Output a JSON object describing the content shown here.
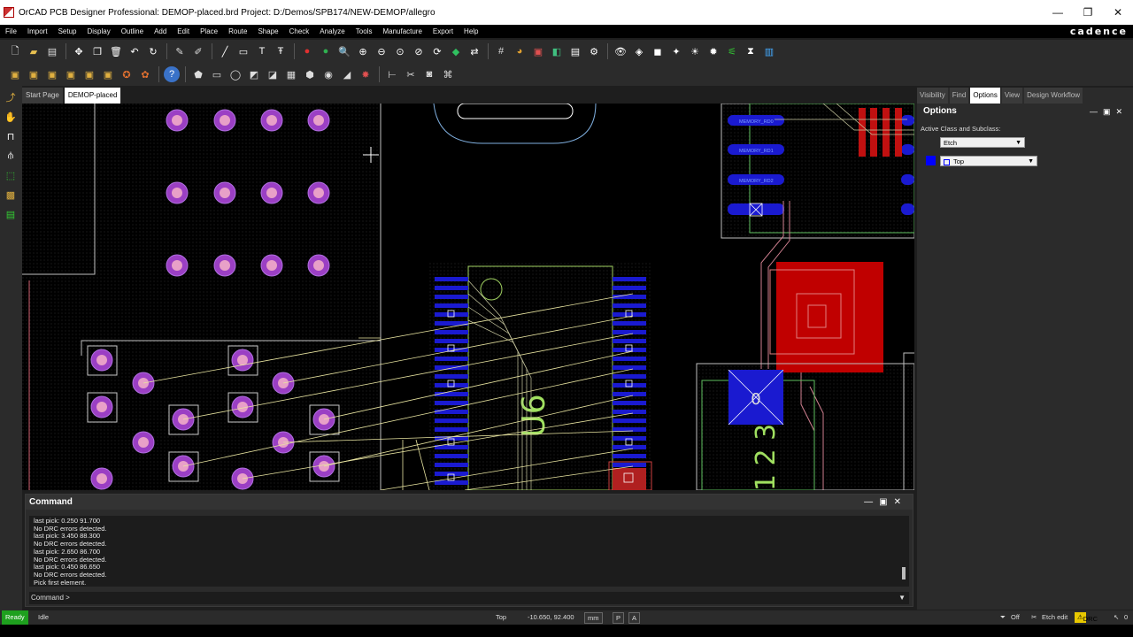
{
  "window": {
    "title": "OrCAD PCB Designer Professional: DEMOP-placed.brd  Project: D:/Demos/SPB174/NEW-DEMOP/allegro",
    "controls": [
      "—",
      "❐",
      "✕"
    ]
  },
  "brand": "cadence",
  "menu": [
    "File",
    "Import",
    "Setup",
    "Display",
    "Outline",
    "Add",
    "Edit",
    "Place",
    "Route",
    "Shape",
    "Check",
    "Analyze",
    "Tools",
    "Manufacture",
    "Export",
    "Help"
  ],
  "tabs": [
    "Start Page",
    "DEMOP-placed"
  ],
  "active_tab": "DEMOP-placed",
  "canvas": {
    "ref_designator": "U6",
    "pad_label": "0",
    "pin_numbers": "1 2 3",
    "net_labels": [
      "MEMORY_RD0",
      "MEMORY_RD1",
      "MEMORY_RD2"
    ],
    "colors": {
      "background": "#000000",
      "pad_purple": "#9b3fc4",
      "pad_blue": "#1a1ad0",
      "pad_red": "#c00000",
      "ratsnest": "#e8e4a0",
      "silkscreen_green": "#a0e060",
      "outline": "#c0c0c0"
    }
  },
  "command_panel": {
    "title": "Command",
    "log": [
      "last pick:  0.250 91.700",
      "No DRC errors detected.",
      "last pick:  3.450 88.300",
      "No DRC errors detected.",
      "last pick:  2.650 86.700",
      "No DRC errors detected.",
      "last pick:  0.450 86.650",
      "No DRC errors detected.",
      "Pick first element."
    ],
    "prompt": "Command >"
  },
  "right_panel": {
    "tabs": [
      "Visibility",
      "Find",
      "Options",
      "View",
      "Design Workflow"
    ],
    "active_tab": "Options",
    "header": "Options",
    "class_label": "Active Class and Subclass:",
    "class_value": "Etch",
    "subclass_value": "Top",
    "subclass_color": "#0000ff"
  },
  "status": {
    "ready": "Ready",
    "state": "Idle",
    "layer": "Top",
    "coords": "-10.650, 92.400",
    "units": "mm",
    "p": "P",
    "a": "A",
    "off": "Off",
    "etch_edit": "Etch edit",
    "drc": "DRC",
    "drc_count": "0"
  }
}
